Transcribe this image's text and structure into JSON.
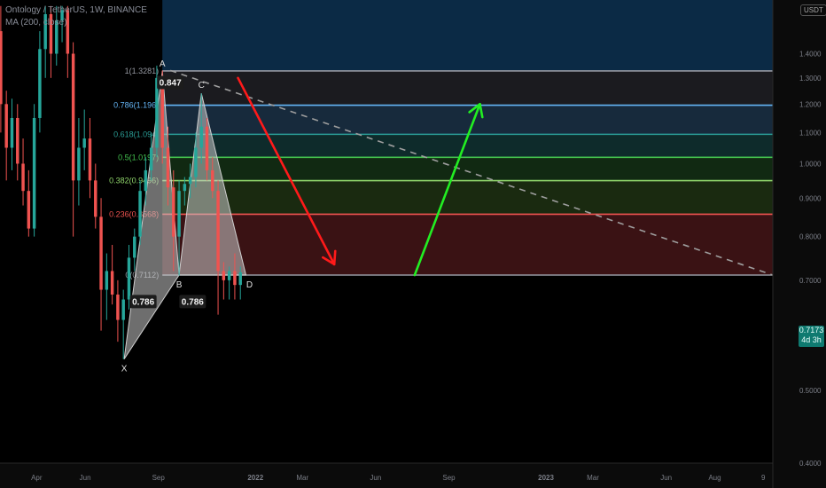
{
  "header": {
    "symbol": "Ontology / TetherUS, 1W, BINANCE",
    "indicator": "MA (200, close)"
  },
  "currency": "USDT",
  "last_price": "0.7173",
  "countdown": "4d 3h",
  "colors": {
    "background": "#000000",
    "candle_up": "#26a69a",
    "candle_down": "#ef5350",
    "trend_line": "#9e9e9e",
    "down_arrow": "#ff1a1a",
    "up_arrow": "#22ee22",
    "harmonic_fill": "#c9c9c9"
  },
  "chart_data": {
    "type": "candlestick",
    "y_scale": "log",
    "ylim": [
      0.4,
      1.65
    ],
    "y_ticks": [
      "1.4000",
      "1.3000",
      "1.2000",
      "1.1000",
      "1.0000",
      "0.9000",
      "0.8000",
      "0.7000",
      "0.6000",
      "0.5000",
      "0.4000"
    ],
    "x_ticks": [
      {
        "label": "Apr",
        "date": "2021-04-01"
      },
      {
        "label": "Jun",
        "date": "2021-06-01"
      },
      {
        "label": "Sep",
        "date": "2021-09-01"
      },
      {
        "label": "2022",
        "date": "2022-01-01"
      },
      {
        "label": "Mar",
        "date": "2022-03-01"
      },
      {
        "label": "Jun",
        "date": "2022-06-01"
      },
      {
        "label": "Sep",
        "date": "2022-09-01"
      },
      {
        "label": "2023",
        "date": "2023-01-01"
      },
      {
        "label": "Mar",
        "date": "2023-03-01"
      },
      {
        "label": "Jun",
        "date": "2023-06-01"
      },
      {
        "label": "Aug",
        "date": "2023-08-01"
      },
      {
        "label": "9",
        "date": "2023-10-01"
      }
    ],
    "fib_levels": [
      {
        "label": "1(1.3281)",
        "value": 1.3281,
        "color": "#9598a1",
        "zone": "#1b1b1f"
      },
      {
        "label": "0.786(1.196)",
        "value": 1.196,
        "color": "#64b5f6",
        "zone": "#172a3c"
      },
      {
        "label": "0.618(1.094)",
        "value": 1.094,
        "color": "#2a9d96",
        "zone": "#0e2b2b"
      },
      {
        "label": "0.5(1.0197)",
        "value": 1.0197,
        "color": "#43c04e",
        "zone": "#112912"
      },
      {
        "label": "0.382(0.9496)",
        "value": 0.9496,
        "color": "#8fd46a",
        "zone": "#1a2a10"
      },
      {
        "label": "0.236(0.8568)",
        "value": 0.8568,
        "color": "#ef5350",
        "zone": "#3a1214"
      },
      {
        "label": "0(0.7112)",
        "value": 0.7112,
        "color": "#9598a1",
        "zone": "#0a4a6a"
      }
    ],
    "pattern_points": [
      {
        "label": "X",
        "date": "2021-07-20",
        "value": 0.55
      },
      {
        "label": "A",
        "date": "2021-09-06",
        "value": 1.3281
      },
      {
        "label": "B",
        "date": "2021-09-27",
        "value": 0.7112
      },
      {
        "label": "C",
        "date": "2021-10-25",
        "value": 1.24
      },
      {
        "label": "D",
        "date": "2021-12-20",
        "value": 0.7112
      }
    ],
    "ratios": [
      {
        "label": "0.786",
        "date": "2021-08-13",
        "value": 0.655
      },
      {
        "label": "0.786",
        "date": "2021-10-14",
        "value": 0.655
      },
      {
        "label": "0.847",
        "date": "2021-09-16",
        "value": 1.28
      }
    ],
    "candles": [
      {
        "date": "2021-01-04",
        "o": 0.52,
        "h": 0.56,
        "l": 0.5,
        "c": 0.54
      },
      {
        "date": "2021-01-11",
        "o": 0.54,
        "h": 0.6,
        "l": 0.53,
        "c": 0.58
      },
      {
        "date": "2021-01-18",
        "o": 0.58,
        "h": 0.72,
        "l": 0.57,
        "c": 0.7
      },
      {
        "date": "2021-01-25",
        "o": 0.7,
        "h": 0.98,
        "l": 0.68,
        "c": 0.95
      },
      {
        "date": "2021-02-01",
        "o": 0.95,
        "h": 1.42,
        "l": 0.9,
        "c": 1.35
      },
      {
        "date": "2021-02-08",
        "o": 1.35,
        "h": 1.62,
        "l": 1.25,
        "c": 1.5
      },
      {
        "date": "2021-02-15",
        "o": 1.5,
        "h": 1.62,
        "l": 1.1,
        "c": 1.2
      },
      {
        "date": "2021-02-22",
        "o": 1.2,
        "h": 1.25,
        "l": 0.95,
        "c": 1.05
      },
      {
        "date": "2021-03-01",
        "o": 1.05,
        "h": 1.22,
        "l": 0.98,
        "c": 1.15
      },
      {
        "date": "2021-03-08",
        "o": 1.15,
        "h": 1.2,
        "l": 0.95,
        "c": 1.0
      },
      {
        "date": "2021-03-15",
        "o": 1.0,
        "h": 1.08,
        "l": 0.88,
        "c": 0.92
      },
      {
        "date": "2021-03-22",
        "o": 0.92,
        "h": 0.98,
        "l": 0.8,
        "c": 0.82
      },
      {
        "date": "2021-03-29",
        "o": 0.82,
        "h": 1.2,
        "l": 0.8,
        "c": 1.15
      },
      {
        "date": "2021-04-05",
        "o": 1.15,
        "h": 1.5,
        "l": 1.1,
        "c": 1.42
      },
      {
        "date": "2021-04-12",
        "o": 1.42,
        "h": 1.62,
        "l": 1.3,
        "c": 1.58
      },
      {
        "date": "2021-04-19",
        "o": 1.58,
        "h": 1.62,
        "l": 1.3,
        "c": 1.4
      },
      {
        "date": "2021-04-26",
        "o": 1.4,
        "h": 1.62,
        "l": 1.35,
        "c": 1.55
      },
      {
        "date": "2021-05-03",
        "o": 1.55,
        "h": 1.62,
        "l": 1.45,
        "c": 1.6
      },
      {
        "date": "2021-05-10",
        "o": 1.6,
        "h": 1.62,
        "l": 1.3,
        "c": 1.4
      },
      {
        "date": "2021-05-17",
        "o": 1.4,
        "h": 1.45,
        "l": 0.8,
        "c": 0.95
      },
      {
        "date": "2021-05-24",
        "o": 0.95,
        "h": 1.15,
        "l": 0.88,
        "c": 1.05
      },
      {
        "date": "2021-05-31",
        "o": 1.05,
        "h": 1.18,
        "l": 0.98,
        "c": 1.08
      },
      {
        "date": "2021-06-07",
        "o": 1.08,
        "h": 1.15,
        "l": 0.9,
        "c": 0.95
      },
      {
        "date": "2021-06-14",
        "o": 0.95,
        "h": 1.0,
        "l": 0.82,
        "c": 0.85
      },
      {
        "date": "2021-06-21",
        "o": 0.85,
        "h": 0.9,
        "l": 0.6,
        "c": 0.68
      },
      {
        "date": "2021-06-28",
        "o": 0.68,
        "h": 0.76,
        "l": 0.62,
        "c": 0.72
      },
      {
        "date": "2021-07-05",
        "o": 0.72,
        "h": 0.78,
        "l": 0.65,
        "c": 0.67
      },
      {
        "date": "2021-07-12",
        "o": 0.67,
        "h": 0.7,
        "l": 0.58,
        "c": 0.62
      },
      {
        "date": "2021-07-19",
        "o": 0.62,
        "h": 0.68,
        "l": 0.55,
        "c": 0.66
      },
      {
        "date": "2021-07-26",
        "o": 0.66,
        "h": 0.78,
        "l": 0.64,
        "c": 0.75
      },
      {
        "date": "2021-08-02",
        "o": 0.75,
        "h": 0.82,
        "l": 0.72,
        "c": 0.8
      },
      {
        "date": "2021-08-09",
        "o": 0.8,
        "h": 0.95,
        "l": 0.78,
        "c": 0.92
      },
      {
        "date": "2021-08-16",
        "o": 0.92,
        "h": 1.02,
        "l": 0.88,
        "c": 0.98
      },
      {
        "date": "2021-08-23",
        "o": 0.98,
        "h": 1.1,
        "l": 0.95,
        "c": 1.05
      },
      {
        "date": "2021-08-30",
        "o": 1.05,
        "h": 1.35,
        "l": 1.02,
        "c": 1.3
      },
      {
        "date": "2021-09-06",
        "o": 1.3,
        "h": 1.33,
        "l": 1.0,
        "c": 1.05
      },
      {
        "date": "2021-09-13",
        "o": 1.05,
        "h": 1.12,
        "l": 0.88,
        "c": 0.93
      },
      {
        "date": "2021-09-20",
        "o": 0.93,
        "h": 0.98,
        "l": 0.72,
        "c": 0.8
      },
      {
        "date": "2021-09-27",
        "o": 0.8,
        "h": 0.95,
        "l": 0.71,
        "c": 0.92
      },
      {
        "date": "2021-10-04",
        "o": 0.92,
        "h": 0.96,
        "l": 0.88,
        "c": 0.94
      },
      {
        "date": "2021-10-11",
        "o": 0.94,
        "h": 1.0,
        "l": 0.9,
        "c": 0.96
      },
      {
        "date": "2021-10-18",
        "o": 0.96,
        "h": 1.1,
        "l": 0.93,
        "c": 1.05
      },
      {
        "date": "2021-10-25",
        "o": 1.05,
        "h": 1.24,
        "l": 1.0,
        "c": 1.12
      },
      {
        "date": "2021-11-01",
        "o": 1.12,
        "h": 1.15,
        "l": 0.95,
        "c": 0.98
      },
      {
        "date": "2021-11-08",
        "o": 0.98,
        "h": 1.02,
        "l": 0.9,
        "c": 0.92
      },
      {
        "date": "2021-11-15",
        "o": 0.92,
        "h": 0.95,
        "l": 0.63,
        "c": 0.72
      },
      {
        "date": "2021-11-22",
        "o": 0.72,
        "h": 0.74,
        "l": 0.66,
        "c": 0.7
      },
      {
        "date": "2021-11-29",
        "o": 0.7,
        "h": 0.73,
        "l": 0.66,
        "c": 0.72
      },
      {
        "date": "2021-12-06",
        "o": 0.72,
        "h": 0.76,
        "l": 0.66,
        "c": 0.69
      },
      {
        "date": "2021-12-13",
        "o": 0.69,
        "h": 0.73,
        "l": 0.66,
        "c": 0.7173
      }
    ]
  }
}
